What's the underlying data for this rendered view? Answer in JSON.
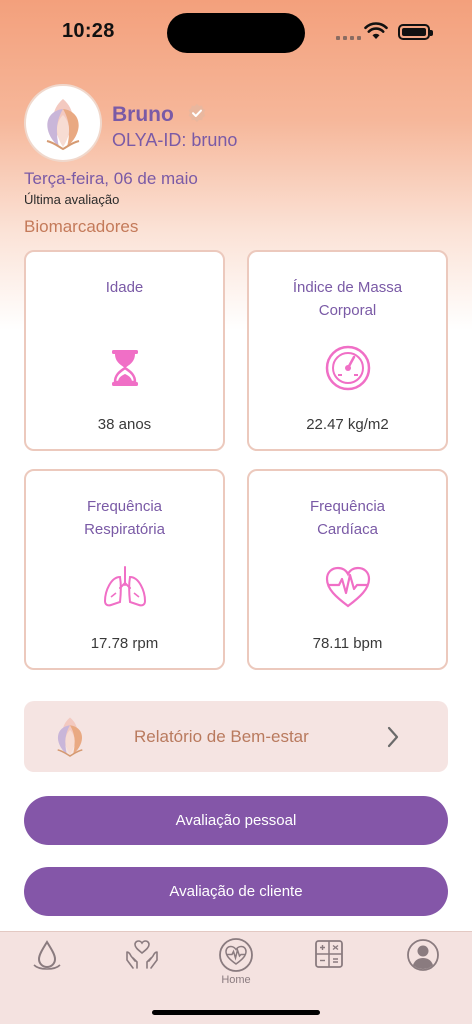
{
  "status": {
    "time": "10:28"
  },
  "profile": {
    "name": "Bruno",
    "olya_id_label": "OLYA-ID:",
    "olya_id_value": "bruno",
    "date": "Terça-feira, 06 de maio",
    "last_eval_label": "Última avaliação"
  },
  "biomarkers": {
    "title": "Biomarcadores",
    "cards": [
      {
        "label": "Idade",
        "value": "38 anos",
        "icon": "hourglass-icon"
      },
      {
        "label": "Índice de Massa Corporal",
        "value": "22.47 kg/m2",
        "icon": "gauge-icon"
      },
      {
        "label": "Frequência Respiratória",
        "value": "17.78 rpm",
        "icon": "lungs-icon"
      },
      {
        "label": "Frequência Cardíaca",
        "value": "78.11 bpm",
        "icon": "heart-pulse-icon"
      }
    ]
  },
  "report": {
    "label": "Relatório de Bem-estar"
  },
  "buttons": {
    "personal": "Avaliação pessoal",
    "client": "Avaliação de cliente"
  },
  "tabbar": {
    "items": [
      {
        "icon": "drop-icon",
        "label": ""
      },
      {
        "icon": "care-hands-icon",
        "label": ""
      },
      {
        "icon": "heartbeat-circle-icon",
        "label": "Home"
      },
      {
        "icon": "calculator-icon",
        "label": ""
      },
      {
        "icon": "profile-icon",
        "label": ""
      }
    ]
  },
  "colors": {
    "accent_purple": "#7a5aa6",
    "button_purple": "#8456a8",
    "icon_pink": "#f06fc6",
    "section_brown": "#c47a5a"
  }
}
